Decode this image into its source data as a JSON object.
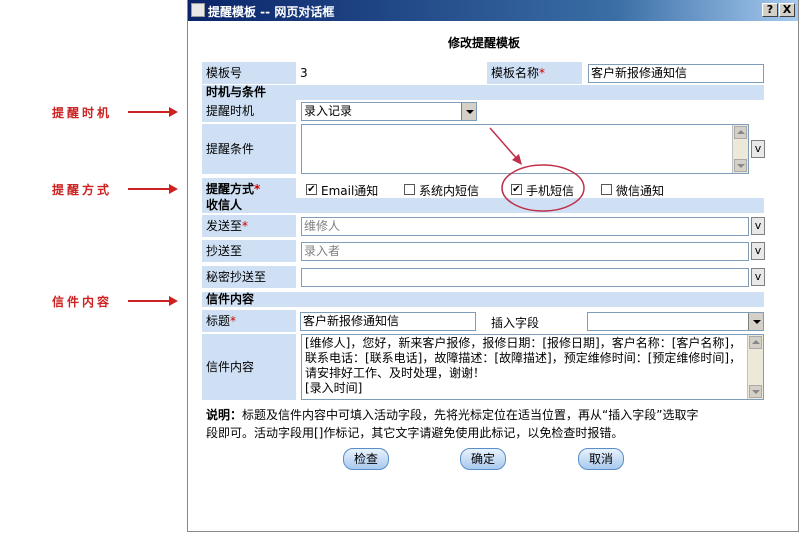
{
  "annotations": {
    "remind_time": "提醒时机",
    "remind_method": "提醒方式",
    "letter_content": "信件内容",
    "color": "#cc2222"
  },
  "window": {
    "title": "提醒模板 -- 网页对话框",
    "help_label": "?",
    "close_label": "X"
  },
  "form": {
    "heading": "修改提醒模板",
    "template_no_label": "模板号",
    "template_no_value": "3",
    "template_name_label": "模板名称",
    "template_name_value": "客户新报修通知信",
    "required_mark": "*",
    "section_time": "时机与条件",
    "remind_time_label": "提醒时机",
    "remind_time_value": "录入记录",
    "remind_condition_label": "提醒条件",
    "remind_condition_value": "",
    "v_label": "v",
    "remind_method_label": "提醒方式",
    "methods": [
      {
        "label": "Email通知",
        "checked": true
      },
      {
        "label": "系统内短信",
        "checked": false
      },
      {
        "label": "手机短信",
        "checked": true
      },
      {
        "label": "微信通知",
        "checked": false
      }
    ],
    "section_recipient": "收信人",
    "to_label": "发送至",
    "to_value": "维修人",
    "cc_label": "抄送至",
    "cc_value": "录入者",
    "bcc_label": "秘密抄送至",
    "bcc_value": "",
    "section_letter": "信件内容",
    "subject_label": "标题",
    "subject_value": "客户新报修通知信",
    "insert_field_label": "插入字段",
    "insert_field_value": "",
    "content_label": "信件内容",
    "content_value": "[维修人]，您好，新来客户报修，报修日期：[报修日期]，客户名称：[客户名称]，联系电话：[联系电话]，故障描述：[故障描述]，预定维修时间：[预定维修时间]，请安排好工作、及时处理，谢谢！\n[录入时间]",
    "note_bold": "说明：",
    "note_line1": "标题及信件内容中可填入活动字段，先将光标定位在适当位置，再从“插入字段”选取字",
    "note_line2": "段即可。活动字段用[]作标记，其它文字请避免使用此标记，以免检查时报错。"
  },
  "buttons": {
    "check": "检查",
    "ok": "确定",
    "cancel": "取消"
  },
  "colors": {
    "label_bg": "#cfe0f5",
    "titlebar_start": "#0a246a",
    "highlight_circle": "#c0304a"
  }
}
